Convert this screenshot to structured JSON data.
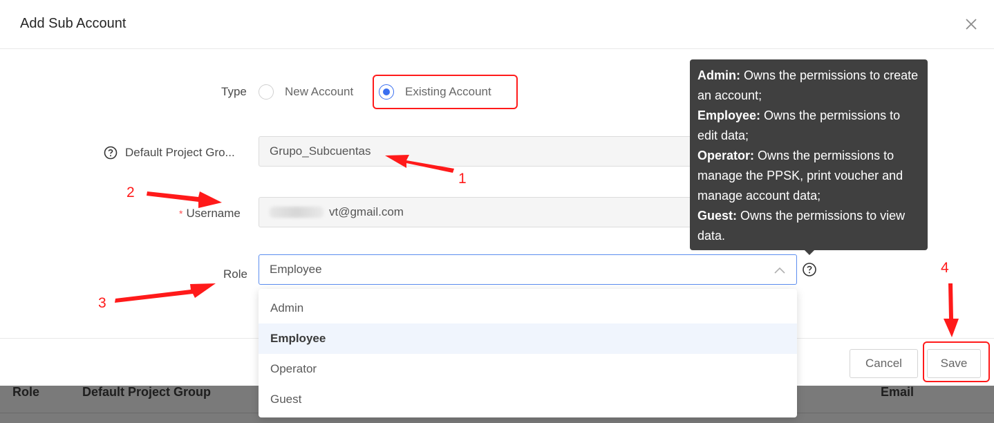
{
  "background_table": {
    "columns": [
      {
        "label": "Role"
      },
      {
        "label": "Default Project Group"
      },
      {
        "label": "Email"
      }
    ]
  },
  "modal": {
    "title": "Add Sub Account",
    "close_icon": "close-icon",
    "form": {
      "type": {
        "label": "Type",
        "options": [
          {
            "label": "New Account",
            "checked": false
          },
          {
            "label": "Existing Account",
            "checked": true
          }
        ]
      },
      "project_group": {
        "label": "Default Project Gro...",
        "value": "Grupo_Subcuentas",
        "help_icon": "question-circle-icon"
      },
      "username": {
        "required_mark": "*",
        "label": "Username",
        "value": "vt@gmail.com"
      },
      "role": {
        "label": "Role",
        "value": "Employee",
        "chevron_icon": "chevron-up-icon",
        "help_icon": "question-circle-icon",
        "options": [
          "Admin",
          "Employee",
          "Operator",
          "Guest"
        ],
        "selected": "Employee"
      }
    },
    "tooltip": {
      "entries": [
        {
          "role": "Admin:",
          "text": " Owns the permissions to create an account;"
        },
        {
          "role": "Employee:",
          "text": " Owns the permissions to edit data;"
        },
        {
          "role": "Operator:",
          "text": " Owns the permissions to manage the PPSK, print voucher and manage account data;"
        },
        {
          "role": "Guest:",
          "text": " Owns the permissions to view data."
        }
      ]
    },
    "footer": {
      "cancel_label": "Cancel",
      "save_label": "Save"
    }
  },
  "annotations": {
    "numbers": [
      "1",
      "2",
      "3",
      "4"
    ],
    "color": "#ff1a1a"
  },
  "colors": {
    "accent": "#3a6ff0",
    "tooltip_bg": "#404040",
    "selected_option_bg": "#f0f5fd"
  }
}
